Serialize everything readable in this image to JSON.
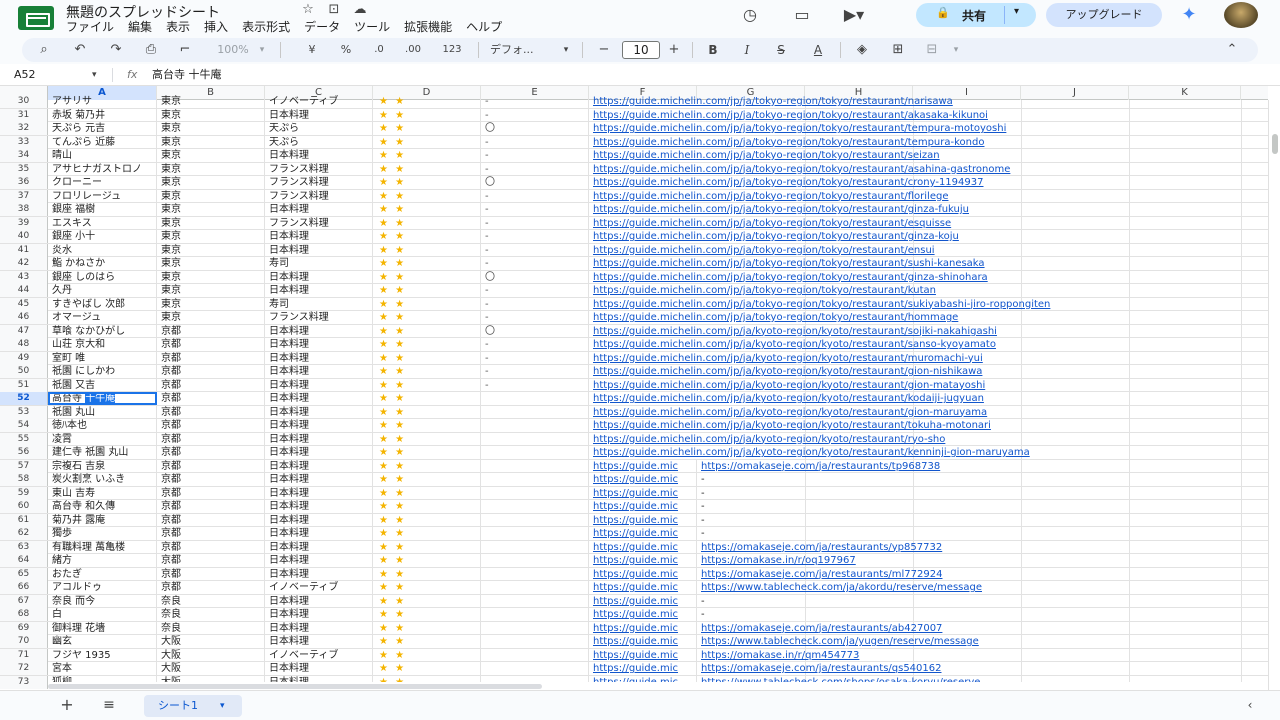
{
  "doc": {
    "title": "無題のスプレッドシート",
    "menu": [
      "ファイル",
      "編集",
      "表示",
      "挿入",
      "表示形式",
      "データ",
      "ツール",
      "拡張機能",
      "ヘルプ"
    ],
    "share_label": "共有",
    "upgrade_label": "アップグレード"
  },
  "toolbar": {
    "zoom": "100%",
    "currency": "¥",
    "percent": "%",
    "dec_less": ".0",
    "dec_more": ".00",
    "number_format": "123",
    "font": "デフォ...",
    "font_size": "10",
    "bold": "B",
    "italic": "I",
    "strike": "S",
    "text_color": "A"
  },
  "formula_bar": {
    "cell_ref": "A52",
    "fx": "fx",
    "content": "高台寺 十牛庵"
  },
  "columns": [
    "A",
    "B",
    "C",
    "D",
    "E",
    "F",
    "G",
    "H",
    "I",
    "J",
    "K"
  ],
  "rows": [
    {
      "n": "30",
      "a": "アサリサ",
      "b": "東京",
      "c": "イノベーティブ",
      "e": "-",
      "f": "https://guide.michelin.com/jp/ja/tokyo-region/tokyo/restaurant/narisawa"
    },
    {
      "n": "31",
      "a": "赤坂 菊乃井",
      "b": "東京",
      "c": "日本料理",
      "e": "-",
      "f": "https://guide.michelin.com/jp/ja/tokyo-region/tokyo/restaurant/akasaka-kikunoi"
    },
    {
      "n": "32",
      "a": "天ぷら 元吉",
      "b": "東京",
      "c": "天ぷら",
      "e": "〇",
      "f": "https://guide.michelin.com/jp/ja/tokyo-region/tokyo/restaurant/tempura-motoyoshi"
    },
    {
      "n": "33",
      "a": "てんぷら 近藤",
      "b": "東京",
      "c": "天ぷら",
      "e": "-",
      "f": "https://guide.michelin.com/jp/ja/tokyo-region/tokyo/restaurant/tempura-kondo"
    },
    {
      "n": "34",
      "a": "晴山",
      "b": "東京",
      "c": "日本料理",
      "e": "-",
      "f": "https://guide.michelin.com/jp/ja/tokyo-region/tokyo/restaurant/seizan"
    },
    {
      "n": "35",
      "a": "アサヒナガストロノ",
      "b": "東京",
      "c": "フランス料理",
      "e": "-",
      "f": "https://guide.michelin.com/jp/ja/tokyo-region/tokyo/restaurant/asahina-gastronome"
    },
    {
      "n": "36",
      "a": "クローニー",
      "b": "東京",
      "c": "フランス料理",
      "e": "〇",
      "f": "https://guide.michelin.com/jp/ja/tokyo-region/tokyo/restaurant/crony-1194937"
    },
    {
      "n": "37",
      "a": "フロリレージュ",
      "b": "東京",
      "c": "フランス料理",
      "e": "-",
      "f": "https://guide.michelin.com/jp/ja/tokyo-region/tokyo/restaurant/florilege"
    },
    {
      "n": "38",
      "a": "銀座 福樹",
      "b": "東京",
      "c": "日本料理",
      "e": "-",
      "f": "https://guide.michelin.com/jp/ja/tokyo-region/tokyo/restaurant/ginza-fukuju"
    },
    {
      "n": "39",
      "a": "エスキス",
      "b": "東京",
      "c": "フランス料理",
      "e": "-",
      "f": "https://guide.michelin.com/jp/ja/tokyo-region/tokyo/restaurant/esquisse"
    },
    {
      "n": "40",
      "a": "銀座 小十",
      "b": "東京",
      "c": "日本料理",
      "e": "-",
      "f": "https://guide.michelin.com/jp/ja/tokyo-region/tokyo/restaurant/ginza-koju"
    },
    {
      "n": "41",
      "a": "炎水",
      "b": "東京",
      "c": "日本料理",
      "e": "-",
      "f": "https://guide.michelin.com/jp/ja/tokyo-region/tokyo/restaurant/ensui"
    },
    {
      "n": "42",
      "a": "鮨 かねさか",
      "b": "東京",
      "c": "寿司",
      "e": "-",
      "f": "https://guide.michelin.com/jp/ja/tokyo-region/tokyo/restaurant/sushi-kanesaka"
    },
    {
      "n": "43",
      "a": "銀座 しのはら",
      "b": "東京",
      "c": "日本料理",
      "e": "〇",
      "f": "https://guide.michelin.com/jp/ja/tokyo-region/tokyo/restaurant/ginza-shinohara"
    },
    {
      "n": "44",
      "a": "久丹",
      "b": "東京",
      "c": "日本料理",
      "e": "-",
      "f": "https://guide.michelin.com/jp/ja/tokyo-region/tokyo/restaurant/kutan"
    },
    {
      "n": "45",
      "a": "すきやばし 次郎",
      "b": "東京",
      "c": "寿司",
      "e": "-",
      "f": "https://guide.michelin.com/jp/ja/tokyo-region/tokyo/restaurant/sukiyabashi-jiro-roppongiten"
    },
    {
      "n": "46",
      "a": "オマージュ",
      "b": "東京",
      "c": "フランス料理",
      "e": "-",
      "f": "https://guide.michelin.com/jp/ja/tokyo-region/tokyo/restaurant/hommage"
    },
    {
      "n": "47",
      "a": "草喰 なかひがし",
      "b": "京都",
      "c": "日本料理",
      "e": "〇",
      "f": "https://guide.michelin.com/jp/ja/kyoto-region/kyoto/restaurant/sojiki-nakahigashi"
    },
    {
      "n": "48",
      "a": "山荘 京大和",
      "b": "京都",
      "c": "日本料理",
      "e": "-",
      "f": "https://guide.michelin.com/jp/ja/kyoto-region/kyoto/restaurant/sanso-kyoyamato"
    },
    {
      "n": "49",
      "a": "室町 唯",
      "b": "京都",
      "c": "日本料理",
      "e": "-",
      "f": "https://guide.michelin.com/jp/ja/kyoto-region/kyoto/restaurant/muromachi-yui"
    },
    {
      "n": "50",
      "a": "祇園 にしかわ",
      "b": "京都",
      "c": "日本料理",
      "e": "-",
      "f": "https://guide.michelin.com/jp/ja/kyoto-region/kyoto/restaurant/gion-nishikawa"
    },
    {
      "n": "51",
      "a": "祇園 又吉",
      "b": "京都",
      "c": "日本料理",
      "e": "-",
      "f": "https://guide.michelin.com/jp/ja/kyoto-region/kyoto/restaurant/gion-matayoshi"
    },
    {
      "n": "52",
      "a": "高台寺 ",
      "a_hl": "十牛庵",
      "b": "京都",
      "c": "日本料理",
      "e": "",
      "f": "https://guide.michelin.com/jp/ja/kyoto-region/kyoto/restaurant/kodaiji-jugyuan"
    },
    {
      "n": "53",
      "a": "祇園 丸山",
      "b": "京都",
      "c": "日本料理",
      "e": "",
      "f": "https://guide.michelin.com/jp/ja/kyoto-region/kyoto/restaurant/gion-maruyama"
    },
    {
      "n": "54",
      "a": "徳ﾊ本也",
      "b": "京都",
      "c": "日本料理",
      "e": "",
      "f": "https://guide.michelin.com/jp/ja/kyoto-region/kyoto/restaurant/tokuha-motonari"
    },
    {
      "n": "55",
      "a": "凌霄",
      "b": "京都",
      "c": "日本料理",
      "e": "",
      "f": "https://guide.michelin.com/jp/ja/kyoto-region/kyoto/restaurant/ryo-sho"
    },
    {
      "n": "56",
      "a": "建仁寺 祇園 丸山",
      "b": "京都",
      "c": "日本料理",
      "e": "",
      "f": "https://guide.michelin.com/jp/ja/kyoto-region/kyoto/restaurant/kenninji-gion-maruyama"
    },
    {
      "n": "57",
      "a": "宗複石 吉泉",
      "b": "京都",
      "c": "日本料理",
      "e": "",
      "f": "https://guide.mic",
      "g": "https://omakaseje.com/ja/restaurants/tp968738"
    },
    {
      "n": "58",
      "a": "炭火割烹 いふき",
      "b": "京都",
      "c": "日本料理",
      "e": "",
      "f": "https://guide.mic",
      "g": "-"
    },
    {
      "n": "59",
      "a": "東山 吉寿",
      "b": "京都",
      "c": "日本料理",
      "e": "",
      "f": "https://guide.mic",
      "g": "-"
    },
    {
      "n": "60",
      "a": "高台寺 和久傳",
      "b": "京都",
      "c": "日本料理",
      "e": "",
      "f": "https://guide.mic",
      "g": "-"
    },
    {
      "n": "61",
      "a": "菊乃井 露庵",
      "b": "京都",
      "c": "日本料理",
      "e": "",
      "f": "https://guide.mic",
      "g": "-"
    },
    {
      "n": "62",
      "a": "獨歩",
      "b": "京都",
      "c": "日本料理",
      "e": "",
      "f": "https://guide.mic",
      "g": "-"
    },
    {
      "n": "63",
      "a": "有職料理 萬亀楼",
      "b": "京都",
      "c": "日本料理",
      "e": "",
      "f": "https://guide.mic",
      "g": "https://omakaseje.com/ja/restaurants/yp857732"
    },
    {
      "n": "64",
      "a": "緒方",
      "b": "京都",
      "c": "日本料理",
      "e": "",
      "f": "https://guide.mic",
      "g": "https://omakase.in/r/oq197967"
    },
    {
      "n": "65",
      "a": "おたぎ",
      "b": "京都",
      "c": "日本料理",
      "e": "",
      "f": "https://guide.mic",
      "g": "https://omakaseje.com/ja/restaurants/ml772924"
    },
    {
      "n": "66",
      "a": "アコルドゥ",
      "b": "京都",
      "c": "イノベーティブ",
      "e": "",
      "f": "https://guide.mic",
      "g": "https://www.tablecheck.com/ja/akordu/reserve/message"
    },
    {
      "n": "67",
      "a": "奈良 而今",
      "b": "奈良",
      "c": "日本料理",
      "e": "",
      "f": "https://guide.mic",
      "g": "-"
    },
    {
      "n": "68",
      "a": "白",
      "b": "奈良",
      "c": "日本料理",
      "e": "",
      "f": "https://guide.mic",
      "g": "-"
    },
    {
      "n": "69",
      "a": "御料理 花墻",
      "b": "奈良",
      "c": "日本料理",
      "e": "",
      "f": "https://guide.mic",
      "g": "https://omakaseje.com/ja/restaurants/ab427007"
    },
    {
      "n": "70",
      "a": "幽玄",
      "b": "大阪",
      "c": "日本料理",
      "e": "",
      "f": "https://guide.mic",
      "g": "https://www.tablecheck.com/ja/yugen/reserve/message"
    },
    {
      "n": "71",
      "a": "フジヤ 1935",
      "b": "大阪",
      "c": "イノベーティブ",
      "e": "",
      "f": "https://guide.mic",
      "g": "https://omakase.in/r/qm454773"
    },
    {
      "n": "72",
      "a": "宮本",
      "b": "大阪",
      "c": "日本料理",
      "e": "",
      "f": "https://guide.mic",
      "g": "https://omakaseje.com/ja/restaurants/qs540162"
    },
    {
      "n": "73",
      "a": "狐柳",
      "b": "大阪",
      "c": "日本料理",
      "e": "",
      "f": "https://guide.mic",
      "g": "https://www.tablecheck.com/shops/osaka-koryu/reserve"
    }
  ],
  "star_rating": 2,
  "stars_text": "★ ★",
  "sheet_tab": "シート1"
}
